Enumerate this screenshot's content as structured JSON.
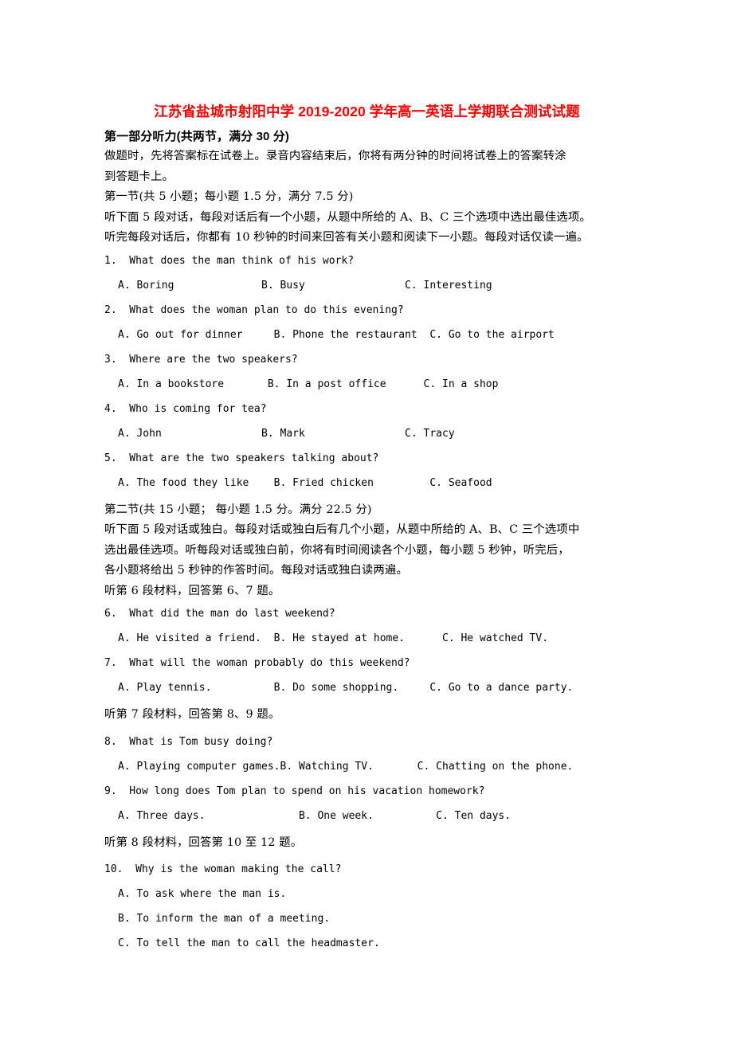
{
  "document": {
    "title": "江苏省盐城市射阳中学 2019-2020 学年高一英语上学期联合测试试题",
    "title_color": "#ff0000",
    "background_color": "#ffffff",
    "text_color": "#000000"
  },
  "part_one": {
    "heading": "第一部分听力(共两节，满分 30 分)",
    "intro_line_1": "做题时，先将答案标在试卷上。录音内容结束后，你将有两分钟的时间将试卷上的答案转涂",
    "intro_line_2": "到答题卡上。"
  },
  "section_one": {
    "heading": "第一节(共 5 小题；每小题 1.5 分，满分 7.5 分)",
    "instruction_line_1": "听下面 5 段对话，每段对话后有一个小题，从题中所给的 A、B、C 三个选项中选出最佳选项。",
    "instruction_line_2": "听完每段对话后，你都有 10 秒钟的时间来回答有关小题和阅读下一小题。每段对话仅读一遍。",
    "questions": [
      {
        "number": "1.",
        "stem": "1.  What does the man think of his work?",
        "options": "A. Boring              B. Busy                C. Interesting"
      },
      {
        "number": "2.",
        "stem": "2.  What does the woman plan to do this evening?",
        "options": "A. Go out for dinner     B. Phone the restaurant  C. Go to the airport"
      },
      {
        "number": "3.",
        "stem": "3.  Where are the two speakers?",
        "options": "A. In a bookstore       B. In a post office      C. In a shop"
      },
      {
        "number": "4.",
        "stem": "4.  Who is coming for tea?",
        "options": "A. John                B. Mark                C. Tracy"
      },
      {
        "number": "5.",
        "stem": "5.  What are the two speakers talking about?",
        "options": "A. The food they like    B. Fried chicken         C. Seafood"
      }
    ]
  },
  "section_two": {
    "heading": "第二节(共 15 小题； 每小题 1.5 分。满分 22.5 分)",
    "instruction_line_1": "听下面 5 段对话或独白。每段对话或独白后有几个小题，从题中所给的 A、B、C 三个选项中",
    "instruction_line_2": "选出最佳选项。听每段对话或独白前，你将有时间阅读各个小题，每小题 5 秒钟，听完后，",
    "instruction_line_3": "各小题将给出 5 秒钟的作答时间。每段对话或独白读两遍。",
    "material_6": "听第 6 段材料，回答第 6、7 题。",
    "material_7": "听第 7 段材料，回答第 8、9 题。",
    "material_8": "听第 8 段材料，回答第 10 至 12 题。",
    "questions": [
      {
        "number": "6.",
        "stem": "6.  What did the man do last weekend?",
        "options": "A. He visited a friend.  B. He stayed at home.      C. He watched TV."
      },
      {
        "number": "7.",
        "stem": "7.  What will the woman probably do this weekend?",
        "options": "A. Play tennis.          B. Do some shopping.     C. Go to a dance party."
      },
      {
        "number": "8.",
        "stem": "8.  What is Tom busy doing?",
        "options": "A. Playing computer games.B. Watching TV.       C. Chatting on the phone."
      },
      {
        "number": "9.",
        "stem": "9.  How long does Tom plan to spend on his vacation homework?",
        "options": "A. Three days.               B. One week.          C. Ten days."
      },
      {
        "number": "10.",
        "stem": "10.  Why is the woman making the call?",
        "option_a": "A. To ask where the man is.",
        "option_b": "B. To inform the man of a meeting.",
        "option_c": "C. To tell the man to call the headmaster."
      }
    ]
  }
}
